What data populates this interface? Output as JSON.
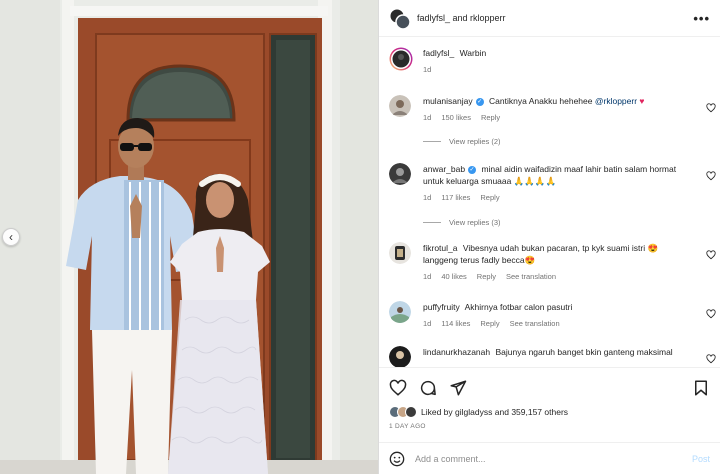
{
  "header": {
    "usernames": "fadlyfsl_ and rklopperr",
    "more_label": "•••"
  },
  "caption": {
    "username": "fadlyfsl_",
    "text": "Warbin",
    "time": "1d"
  },
  "comments": [
    {
      "username": "mulanisanjay",
      "verified": true,
      "text": "Cantiknya Anakku hehehee",
      "mention": "@rklopperr",
      "emoji": "♥",
      "time": "1d",
      "likes": "150 likes",
      "reply": "Reply",
      "view_replies": "View replies (2)"
    },
    {
      "username": "anwar_bab",
      "verified": true,
      "text": "minal aidin waifadizin maaf lahir batin salam hormat untuk keluarga smuaaa 🙏🙏🙏🙏",
      "time": "1d",
      "likes": "117 likes",
      "reply": "Reply",
      "view_replies": "View replies (3)"
    },
    {
      "username": "fikrotul_a",
      "verified": false,
      "text": "Vibesnya udah bukan pacaran, tp kyk suami istri 😍 langgeng terus fadly becca😍",
      "time": "1d",
      "likes": "40 likes",
      "reply": "Reply",
      "translate": "See translation"
    },
    {
      "username": "puffyfruity",
      "verified": false,
      "text": "Akhirnya fotbar calon pasutri",
      "time": "1d",
      "likes": "114 likes",
      "reply": "Reply",
      "translate": "See translation"
    },
    {
      "username": "lindanurkhazanah",
      "verified": false,
      "text": "Bajunya ngaruh banget bkin ganteng maksimal",
      "time": "",
      "likes": "",
      "reply": ""
    }
  ],
  "likes": {
    "prefix": "Liked by",
    "user": "gilgladyss",
    "middle": "and",
    "count": "359,157 others"
  },
  "date": "1 DAY AGO",
  "add_comment": {
    "placeholder": "Add a comment...",
    "post_label": "Post"
  },
  "nav": {
    "prev": "‹"
  },
  "colors": {
    "verified": "#3897f0",
    "link": "#00376b",
    "post_disabled": "#b3dbff",
    "door": "#9a4a2a"
  }
}
